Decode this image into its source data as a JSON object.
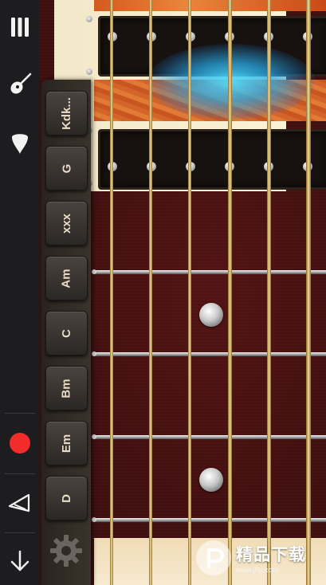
{
  "toolbar": {
    "icons": [
      "menu-icon",
      "guitar-icon",
      "pick-icon",
      "record-icon",
      "metronome-icon",
      "down-arrow-icon"
    ],
    "record_color": "#f22b2b"
  },
  "chords": [
    "Kdk...",
    "G",
    "xxx",
    "Am",
    "C",
    "Bm",
    "Em",
    "D"
  ],
  "settings_icon": "gear-icon",
  "watermark": {
    "title": "精品下载",
    "url": "www.j9p.com"
  },
  "colors": {
    "glow": "#4fd8ff",
    "fretboard": "#3d0f0f",
    "body": "#f6edd0"
  }
}
